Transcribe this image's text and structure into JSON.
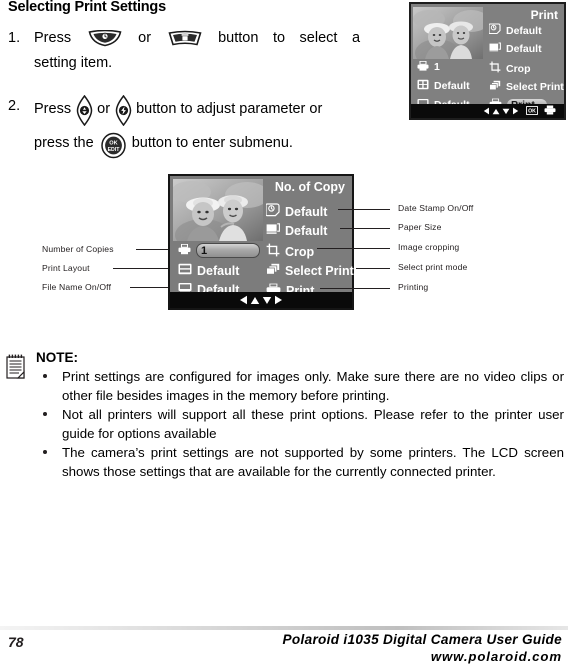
{
  "section": {
    "title": "Selecting Print Settings"
  },
  "steps": [
    {
      "num": "1.",
      "pre": "Press",
      "mid": "or",
      "post": "button  to  select  a",
      "line2": "setting item.",
      "icon_left": "shutter-wedge-button-icon",
      "icon_right": "delete-wedge-button-icon"
    },
    {
      "num": "2.",
      "pre": "Press",
      "mid": "or",
      "post": "button to adjust parameter or",
      "line2_pre": "press the",
      "line2_post": "button to enter submenu.",
      "icon_left": "macro-left-nav-button-icon",
      "icon_right": "flash-right-nav-button-icon",
      "icon_ok": "ok-edit-button-icon"
    }
  ],
  "lcd_small": {
    "title": "Print",
    "left_rows": [
      {
        "icon": "number-of-copies-icon",
        "value": "1"
      },
      {
        "icon": "print-layout-icon",
        "value": "Default"
      },
      {
        "icon": "file-name-icon",
        "value": "Default"
      }
    ],
    "right_rows": [
      {
        "icon": "date-stamp-icon",
        "value": "Default"
      },
      {
        "icon": "paper-size-icon",
        "value": "Default"
      },
      {
        "icon": "crop-icon",
        "value": "Crop"
      },
      {
        "icon": "select-print-icon",
        "value": "Select Print"
      },
      {
        "icon": "printer-icon",
        "value": "Print",
        "highlighted": true
      }
    ],
    "bottom_bar": [
      "left-arrow-icon",
      "up-arrow-icon",
      "down-arrow-icon",
      "right-arrow-icon",
      "ok-icon",
      "printer-icon"
    ]
  },
  "lcd_main": {
    "title": "No. of Copy",
    "left_rows": [
      {
        "icon": "number-of-copies-icon",
        "value": "1",
        "field": true
      },
      {
        "icon": "print-layout-icon",
        "value": "Default"
      },
      {
        "icon": "file-name-icon",
        "value": "Default"
      }
    ],
    "right_rows": [
      {
        "icon": "date-stamp-icon",
        "value": "Default"
      },
      {
        "icon": "paper-size-icon",
        "value": "Default"
      },
      {
        "icon": "crop-icon",
        "value": "Crop"
      },
      {
        "icon": "select-print-icon",
        "value": "Select Print"
      },
      {
        "icon": "printer-icon",
        "value": "Print"
      }
    ],
    "bottom_bar": [
      "left-arrow-icon",
      "up-arrow-icon",
      "down-arrow-icon",
      "right-arrow-icon"
    ]
  },
  "callouts": {
    "left": [
      "Number of Copies",
      "Print Layout",
      "File Name On/Off"
    ],
    "right": [
      "Date Stamp On/Off",
      "Paper Size",
      "Image cropping",
      "Select print mode",
      "Printing"
    ]
  },
  "note": {
    "icon": "note-pad-icon",
    "title": "NOTE:",
    "items": [
      "Print settings are configured for images only. Make sure there are no video clips or other file besides images in the memory before printing.",
      "Not all printers will support all these print options. Please refer to the printer user guide for options available",
      "The camera’s print settings are not supported by some printers. The LCD screen shows those settings that are available for the currently connected printer."
    ]
  },
  "footer": {
    "page_number": "78",
    "guide_title": "Polaroid i1035 Digital Camera User Guide",
    "url": "www.polaroid.com"
  },
  "colors": {
    "lcd_bg": "#7c7c7c",
    "lcd_bg_small": "#808080",
    "lcd_bar": "#0a0a0a",
    "text": "#231f20",
    "lcd_text": "#ffffff"
  }
}
